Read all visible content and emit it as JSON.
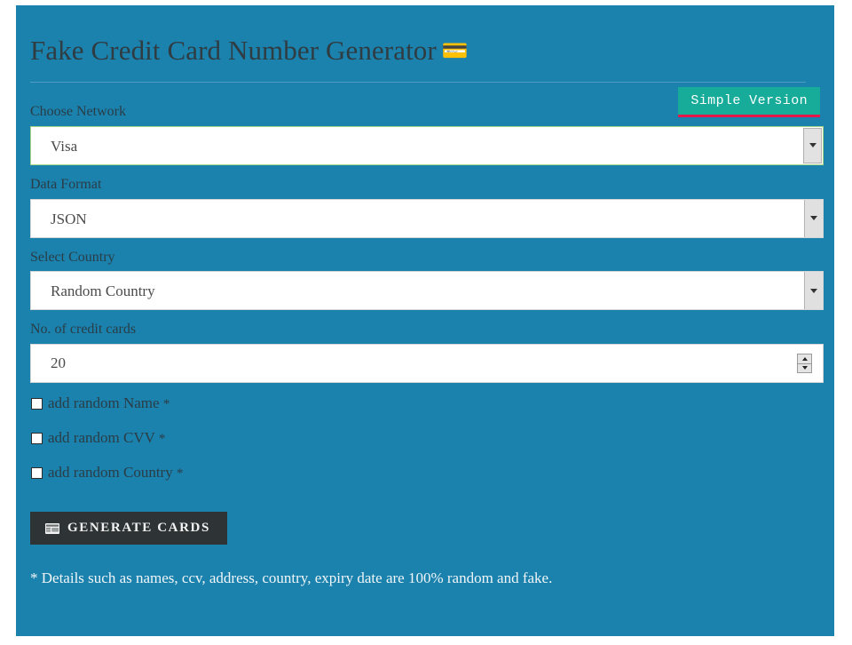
{
  "theme": {
    "panel_bg": "#1b81ad",
    "page_bg": "#ffffff",
    "accent_badge_bg": "#17ab9a",
    "accent_badge_underline": "#e8154a",
    "button_bg": "#2e3436",
    "label_color": "#2a3d46",
    "focus_border": "#a8d685"
  },
  "header": {
    "title": "Fake Credit Card Number Generator",
    "title_emoji": "💳",
    "simple_version_label": "Simple Version"
  },
  "form": {
    "network": {
      "label": "Choose Network",
      "value": "Visa",
      "options": [
        "Visa"
      ]
    },
    "format": {
      "label": "Data Format",
      "value": "JSON",
      "options": [
        "JSON"
      ]
    },
    "country": {
      "label": "Select Country",
      "value": "Random Country",
      "options": [
        "Random Country"
      ]
    },
    "count": {
      "label": "No. of credit cards",
      "value": "20"
    },
    "checkboxes": [
      {
        "label": "add random Name",
        "star": "*",
        "checked": false
      },
      {
        "label": "add random CVV",
        "star": "*",
        "checked": false
      },
      {
        "label": "add random Country",
        "star": "*",
        "checked": false
      }
    ],
    "submit_label": "Generate Cards",
    "submit_icon": "credit-card-icon"
  },
  "footer": {
    "note": "* Details such as names, ccv, address, country, expiry date are 100% random and fake."
  }
}
